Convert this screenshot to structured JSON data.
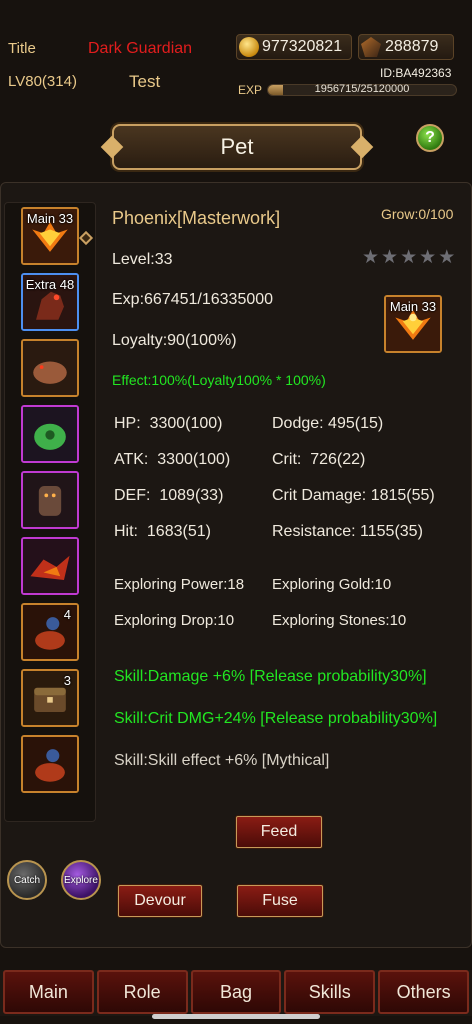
{
  "header": {
    "title_label": "Title",
    "title_value": "Dark Guardian",
    "level": "LV80(314)",
    "player_name": "Test",
    "gold": "977320821",
    "stones": "288879",
    "player_id": "ID:BA492363",
    "exp_label": "EXP",
    "exp_text": "1956715/25120000",
    "exp_progress": 0.078
  },
  "banner": {
    "title": "Pet",
    "help": "?"
  },
  "pet_list": [
    {
      "label": "Main 33",
      "count": "",
      "color": "orange",
      "icon": "phoenix-icon"
    },
    {
      "label": "Extra 48",
      "count": "",
      "color": "blue",
      "icon": "horse-icon"
    },
    {
      "label": "",
      "count": "",
      "color": "orange",
      "icon": "beast-icon"
    },
    {
      "label": "",
      "count": "",
      "color": "purple",
      "icon": "slime-icon"
    },
    {
      "label": "",
      "count": "",
      "color": "purple",
      "icon": "golem-icon"
    },
    {
      "label": "",
      "count": "",
      "color": "purple",
      "icon": "dragon-icon"
    },
    {
      "label": "",
      "count": "4",
      "color": "orange",
      "icon": "rider-icon"
    },
    {
      "label": "",
      "count": "3",
      "color": "orange",
      "icon": "chest-icon"
    },
    {
      "label": "",
      "count": "",
      "color": "orange",
      "icon": "rider-icon"
    }
  ],
  "pet": {
    "name": "Phoenix[Masterwork]",
    "grow": "Grow:0/100",
    "stars_filled": 0,
    "stars_total": 5,
    "level": "Level:33",
    "exp": "Exp:667451/16335000",
    "loyalty": "Loyalty:90(100%)",
    "effect": "Effect:100%(Loyalty100% * 100%)",
    "portrait_label": "Main 33",
    "stats": {
      "hp_label": "HP:",
      "hp_value": "3300(100)",
      "atk_label": "ATK:",
      "atk_value": "3300(100)",
      "def_label": "DEF:",
      "def_value": "1089(33)",
      "hit_label": "Hit:",
      "hit_value": "1683(51)",
      "dodge_label": "Dodge:",
      "dodge_value": "495(15)",
      "crit_label": "Crit:",
      "crit_value": "726(22)",
      "crit_dmg_label": "Crit Damage:",
      "crit_dmg_value": "1815(55)",
      "resistance_label": "Resistance:",
      "resistance_value": "1155(35)"
    },
    "exploring": {
      "power": "Exploring Power:18",
      "gold": "Exploring Gold:10",
      "drop": "Exploring Drop:10",
      "stones": "Exploring Stones:10"
    },
    "skills": [
      "Skill:Damage +6% [Release probability30%]",
      "Skill:Crit DMG+24% [Release probability30%]",
      "Skill:Skill effect +6% [Mythical]"
    ]
  },
  "actions": {
    "feed": "Feed",
    "devour": "Devour",
    "fuse": "Fuse",
    "catch": "Catch",
    "explore": "Explore"
  },
  "nav": [
    "Main",
    "Role",
    "Bag",
    "Skills",
    "Others"
  ],
  "colors": {
    "accent_gold": "#e9c98a",
    "title_red": "#e21d1d",
    "skill_green": "#22e622"
  }
}
